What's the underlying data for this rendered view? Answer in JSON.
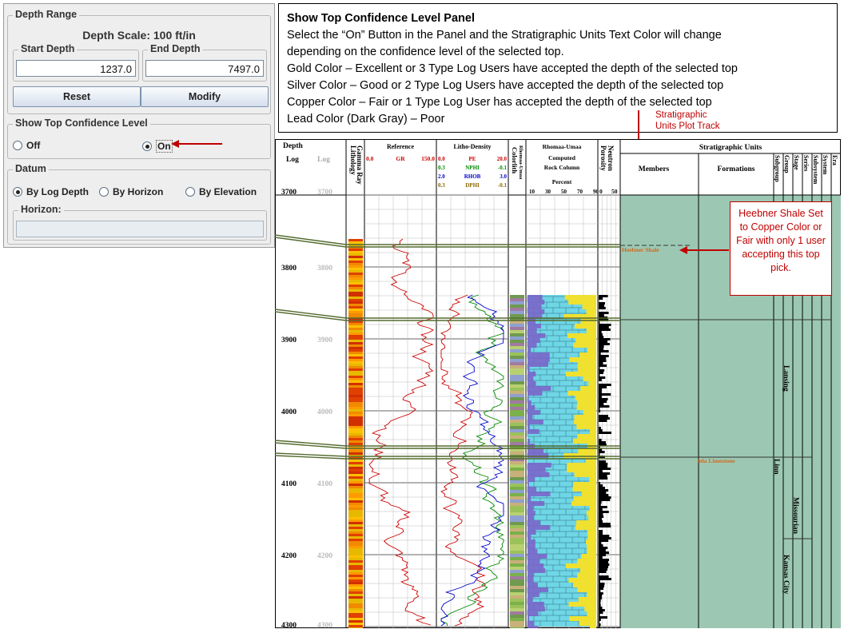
{
  "panel": {
    "depth_range": {
      "title": "Depth Range",
      "scale_label": "Depth Scale: 100 ft/in",
      "start": {
        "label": "Start Depth",
        "value": "1237.0"
      },
      "end": {
        "label": "End Depth",
        "value": "7497.0"
      },
      "reset_label": "Reset",
      "modify_label": "Modify"
    },
    "confidence": {
      "title": "Show Top Confidence Level",
      "off_label": "Off",
      "on_label": "On",
      "selected": "On"
    },
    "datum": {
      "title": "Datum",
      "options": [
        "By Log Depth",
        "By Horizon",
        "By Elevation"
      ],
      "selected": "By Log Depth",
      "horizon_label": "Horizon:",
      "horizon_value": ""
    }
  },
  "description": {
    "title": "Show Top Confidence Level Panel",
    "lines": [
      "Select the “On” Button in the Panel and the Stratigraphic Units Text Color will change",
      "depending on the confidence level of the selected top.",
      "Gold Color – Excellent or 3 Type Log Users have accepted the depth of the selected top",
      "Silver Color – Good or 2 Type Log Users have accepted the depth of the selected top",
      "Copper Color – Fair or 1 Type Log User has accepted the depth of the selected top",
      "Lead Color (Dark Gray) – Poor"
    ]
  },
  "annotations": {
    "strat_track": "Stratigraphic\nUnits Plot Track",
    "heebner_note": "Heebner Shale Set to Copper Color or Fair with only 1 user accepting this top pick."
  },
  "log": {
    "depth_header": "Depth",
    "log_header": "Log",
    "log_header_gray": "Log",
    "lithology_header": "Lithology",
    "gamma_header": "Gamma Ray",
    "reference_header": "Reference",
    "gr": {
      "min": "0.0",
      "name": "GR",
      "max": "150.0"
    },
    "litho_density_header": "Litho-Density",
    "density_curves": [
      {
        "min": "0.0",
        "name": "PE",
        "max": "20.0",
        "color": "#cc0000"
      },
      {
        "min": "0.3",
        "name": "NPHI",
        "max": "-0.1",
        "color": "#008800"
      },
      {
        "min": "2.0",
        "name": "RHOB",
        "max": "3.0",
        "color": "#0000cc"
      },
      {
        "min": "0.3",
        "name": "DPHI",
        "max": "-0.1",
        "color": "#886600"
      }
    ],
    "rhomaa_umaa_header": "Rhomaa-Umaa",
    "colorlith_header": "Colorlith",
    "rhomaa_umaa_small": "Rhomaa-Umaa",
    "computed_lines": [
      "Computed",
      "Rock Column"
    ],
    "percent_label": "Percent",
    "percent_ticks": [
      "10",
      "30",
      "50",
      "70",
      "90"
    ],
    "porosity_header": "Porosity",
    "neutron_header": "Neutron",
    "porosity_ticks": [
      "0",
      "50"
    ],
    "strat_header": "Stratigraphic Units",
    "members_header": "Members",
    "formations_header": "Formations",
    "strat_cols": [
      "Subgroup",
      "Group",
      "Stage",
      "Series",
      "Subsystem",
      "System",
      "Era"
    ],
    "depths": [
      "3700",
      "3800",
      "3900",
      "4000",
      "4100",
      "4200",
      "4300"
    ],
    "heebner_label": "Heebner Shale",
    "iola_label": "Iola Limestone",
    "lansing_label": "Lansing",
    "linn_label": "Linn",
    "missourian_label": "Missourian",
    "kansas_city_label": "Kansas City",
    "colors": {
      "copper": "#d2691e",
      "strat_fill": "#9cc8b3"
    }
  }
}
